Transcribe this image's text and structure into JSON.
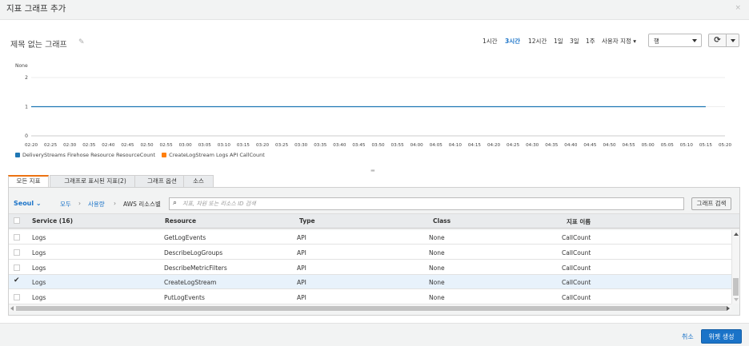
{
  "dialog": {
    "title": "지표 그래프 추가",
    "close_label": "×"
  },
  "graph": {
    "title": "제목 없는 그래프",
    "ranges": [
      "1시간",
      "3시간",
      "12시간",
      "1일",
      "3일",
      "1주"
    ],
    "active_range": "3시간",
    "custom_range_label": "사용자 지정 ▾",
    "chart_type_selected": "행",
    "refresh_icon": "⟳"
  },
  "chart_data": {
    "type": "line",
    "ylabel": "None",
    "ylim": [
      0,
      2
    ],
    "yticks": [
      "0",
      "1",
      "2"
    ],
    "x": [
      "02:20",
      "02:25",
      "02:30",
      "02:35",
      "02:40",
      "02:45",
      "02:50",
      "02:55",
      "03:00",
      "03:05",
      "03:10",
      "03:15",
      "03:20",
      "03:25",
      "03:30",
      "03:35",
      "03:40",
      "03:45",
      "03:50",
      "03:55",
      "04:00",
      "04:05",
      "04:10",
      "04:15",
      "04:20",
      "04:25",
      "04:30",
      "04:35",
      "04:40",
      "04:45",
      "04:50",
      "04:55",
      "05:00",
      "05:05",
      "05:10",
      "05:15",
      "05:20"
    ],
    "series": [
      {
        "name": "DeliveryStreams Firehose Resource ResourceCount",
        "color": "#1f77b4",
        "y_constant": 1,
        "x_start": "02:20",
        "x_end": "05:15"
      },
      {
        "name": "CreateLogStream Logs API CallCount",
        "color": "#ff7f0e",
        "values": []
      }
    ],
    "grid": true,
    "legend": "bottom-left"
  },
  "tabs": [
    {
      "label": "모든 지표",
      "active": true
    },
    {
      "label": "그래프로 표시된 지표(2)",
      "active": false
    },
    {
      "label": "그래프 옵션",
      "active": false
    },
    {
      "label": "소스",
      "active": false
    }
  ],
  "browser": {
    "region": "Seoul",
    "crumbs": [
      "모두",
      "사용량",
      "AWS 리소스별"
    ],
    "search_placeholder": "지표, 차원 또는 리소스 ID 검색",
    "search_button": "그래프 검색",
    "columns": [
      "Service (16)",
      "Resource",
      "Type",
      "Class",
      "지표 이름"
    ],
    "rows": [
      {
        "service": "Logs",
        "resource": "GetLogEvents",
        "type": "API",
        "class": "None",
        "metric": "CallCount",
        "checked": false
      },
      {
        "service": "Logs",
        "resource": "DescribeLogGroups",
        "type": "API",
        "class": "None",
        "metric": "CallCount",
        "checked": false
      },
      {
        "service": "Logs",
        "resource": "DescribeMetricFilters",
        "type": "API",
        "class": "None",
        "metric": "CallCount",
        "checked": false
      },
      {
        "service": "Logs",
        "resource": "CreateLogStream",
        "type": "API",
        "class": "None",
        "metric": "CallCount",
        "checked": true
      },
      {
        "service": "Logs",
        "resource": "PutLogEvents",
        "type": "API",
        "class": "None",
        "metric": "CallCount",
        "checked": false
      }
    ]
  },
  "footer": {
    "cancel": "취소",
    "create": "위젯 생성"
  }
}
